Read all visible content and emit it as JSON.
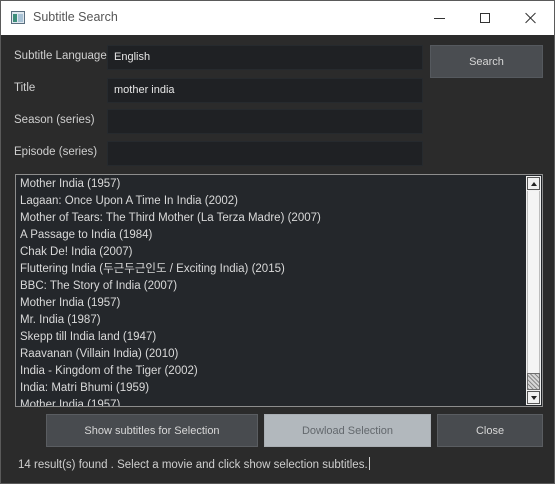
{
  "window": {
    "title": "Subtitle Search"
  },
  "form": {
    "language_label": "Subtitle Language",
    "language_value": "English",
    "title_label": "Title",
    "title_value": "mother india",
    "season_label": "Season (series)",
    "season_value": "",
    "episode_label": "Episode (series)",
    "episode_value": ""
  },
  "buttons": {
    "search": "Search",
    "show_subtitles": "Show subtitles for Selection",
    "download": "Dowload Selection",
    "close": "Close"
  },
  "results": [
    "Mother India (1957)",
    "Lagaan: Once Upon A Time In India (2002)",
    "Mother of Tears: The Third Mother (La Terza Madre) (2007)",
    "A Passage to India (1984)",
    "Chak De! India (2007)",
    "Fluttering India (두근두근인도 / Exciting India) (2015)",
    "BBC: The Story of India (2007)",
    "Mother India (1957)",
    "Mr. India (1987)",
    "Skepp till India land (1947)",
    "Raavanan (Villain India) (2010)",
    "India - Kingdom of the Tiger (2002)",
    "India: Matri Bhumi (1959)",
    "Mother India (1957)"
  ],
  "status": {
    "text": "14 result(s) found . Select a movie and click show selection subtitles."
  },
  "icons": {
    "app": "app-window-icon",
    "minimize": "minimize-icon",
    "maximize": "maximize-icon",
    "close": "close-icon"
  }
}
